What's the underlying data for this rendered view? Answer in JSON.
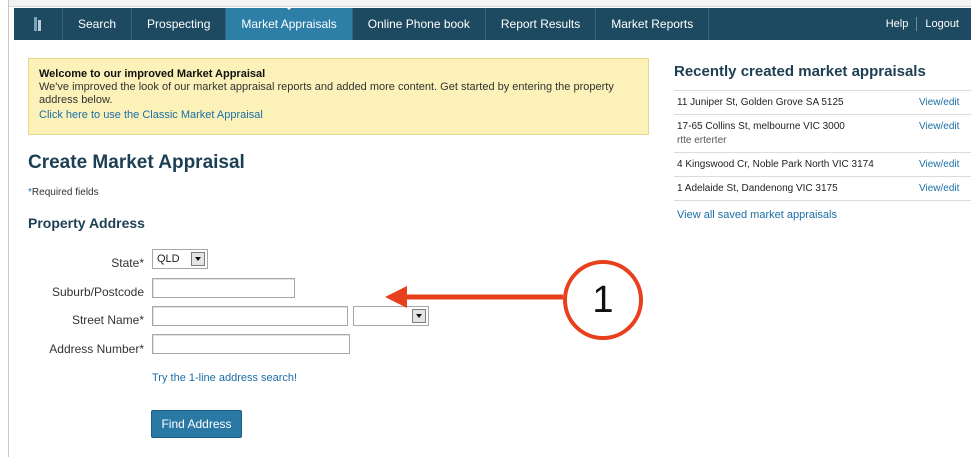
{
  "nav": {
    "items": [
      {
        "label": "Search"
      },
      {
        "label": "Prospecting"
      },
      {
        "label": "Market Appraisals"
      },
      {
        "label": "Online Phone book"
      },
      {
        "label": "Report Results"
      },
      {
        "label": "Market Reports"
      }
    ],
    "active_index": 2,
    "help": "Help",
    "logout": "Logout"
  },
  "welcome": {
    "title": "Welcome to our improved Market Appraisal",
    "text": "We've improved the look of our market appraisal reports and added more content. Get started by entering the property address below.",
    "link": "Click here to use the Classic Market Appraisal"
  },
  "page_title": "Create Market Appraisal",
  "required": {
    "star": "*",
    "text": "Required fields"
  },
  "section_title": "Property Address",
  "form": {
    "state_label": "State*",
    "state_value": "QLD",
    "suburb_label": "Suburb/Postcode",
    "suburb_value": "",
    "street_label": "Street Name*",
    "street_value": "",
    "street_type_value": "",
    "number_label": "Address Number*",
    "number_value": "",
    "one_line_link": "Try the 1-line address search!",
    "submit": "Find Address"
  },
  "recent": {
    "title": "Recently created market appraisals",
    "rows": [
      {
        "address": "11 Juniper St, Golden Grove SA 5125",
        "sub": "",
        "action": "View/edit"
      },
      {
        "address": "17-65 Collins St, melbourne VIC 3000",
        "sub": "rtte erterter",
        "action": "View/edit"
      },
      {
        "address": "4 Kingswood Cr, Noble Park North VIC 3174",
        "sub": "",
        "action": "View/edit"
      },
      {
        "address": "1 Adelaide St, Dandenong VIC 3175",
        "sub": "",
        "action": "View/edit"
      }
    ],
    "view_all": "View all saved market appraisals"
  },
  "annotation": {
    "number": "1",
    "color": "#e8401c"
  },
  "colors": {
    "nav_bg": "#1d4a60",
    "nav_active": "#2d7fa8",
    "link": "#1b6fa6",
    "welcome_bg": "#fbf1b9",
    "button": "#2979a4"
  }
}
